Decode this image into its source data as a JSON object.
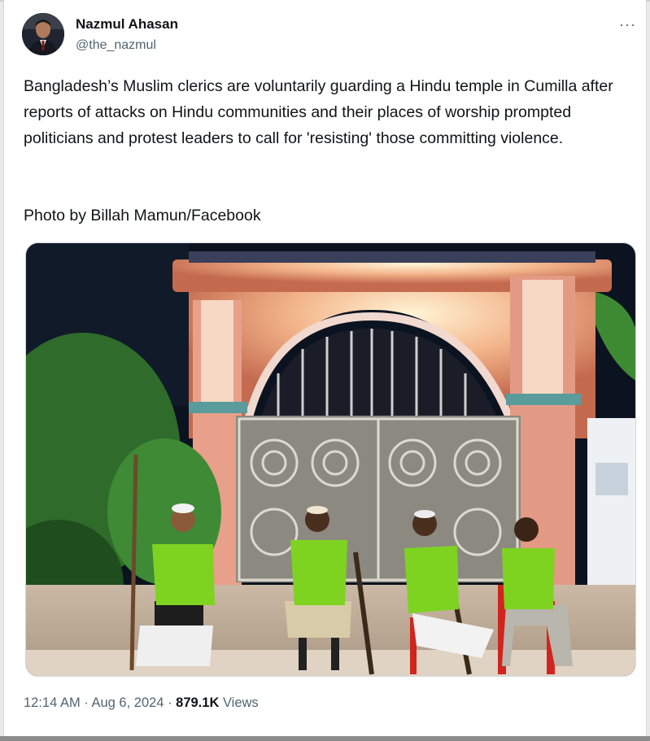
{
  "author": {
    "name": "Nazmul Ahasan",
    "handle": "@the_nazmul"
  },
  "more_label": "···",
  "tweet": {
    "text": "Bangladesh’s Muslim clerics are voluntarily guarding a Hindu temple in Cumilla after reports of attacks on Hindu communities and their places of worship prompted politicians and protest leaders to call for 'resisting' those committing violence.",
    "credit": "Photo by Billah Mamun/Facebook"
  },
  "meta": {
    "time": "12:14 AM",
    "separator1": " · ",
    "date": "Aug 6, 2024",
    "separator2": " · ",
    "views_count": "879.1K",
    "views_label": " Views"
  },
  "colors": {
    "vest_green": "#7ed321",
    "gate_pink": "#e79a86",
    "gate_metal": "#c9c7bd",
    "night": "#0c1320"
  }
}
